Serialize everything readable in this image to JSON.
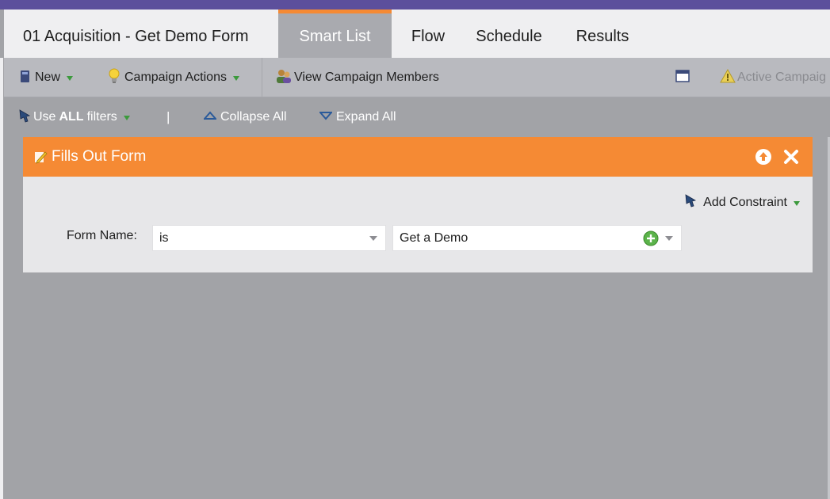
{
  "tabs": {
    "campaign_title": "01 Acquisition - Get Demo Form",
    "items": [
      {
        "label": "Smart List",
        "active": true
      },
      {
        "label": "Flow"
      },
      {
        "label": "Schedule"
      },
      {
        "label": "Results"
      }
    ]
  },
  "toolbar": {
    "new_label": "New",
    "campaign_actions_label": "Campaign Actions",
    "view_members_label": "View Campaign Members",
    "active_campaign_label": "Active Campaig"
  },
  "filterbar": {
    "use_prefix": "Use",
    "use_bold": "ALL",
    "use_suffix": "filters",
    "pipe": "|",
    "collapse_label": "Collapse All",
    "expand_label": "Expand All"
  },
  "filter_card": {
    "title": "Fills Out Form",
    "add_constraint_label": "Add Constraint",
    "field_label": "Form Name:",
    "operator_value": "is",
    "value": "Get a Demo"
  },
  "colors": {
    "header_purple": "#5c4f9c",
    "accent_orange": "#f58a34",
    "add_green": "#3c9a3c"
  },
  "icons": [
    "new-icon",
    "lightbulb-icon",
    "people-icon",
    "window-icon",
    "warning-icon",
    "funnel-icon",
    "collapse-icon",
    "expand-icon",
    "form-pencil-icon",
    "up-arrow-icon",
    "close-icon",
    "plus-circle-icon"
  ]
}
